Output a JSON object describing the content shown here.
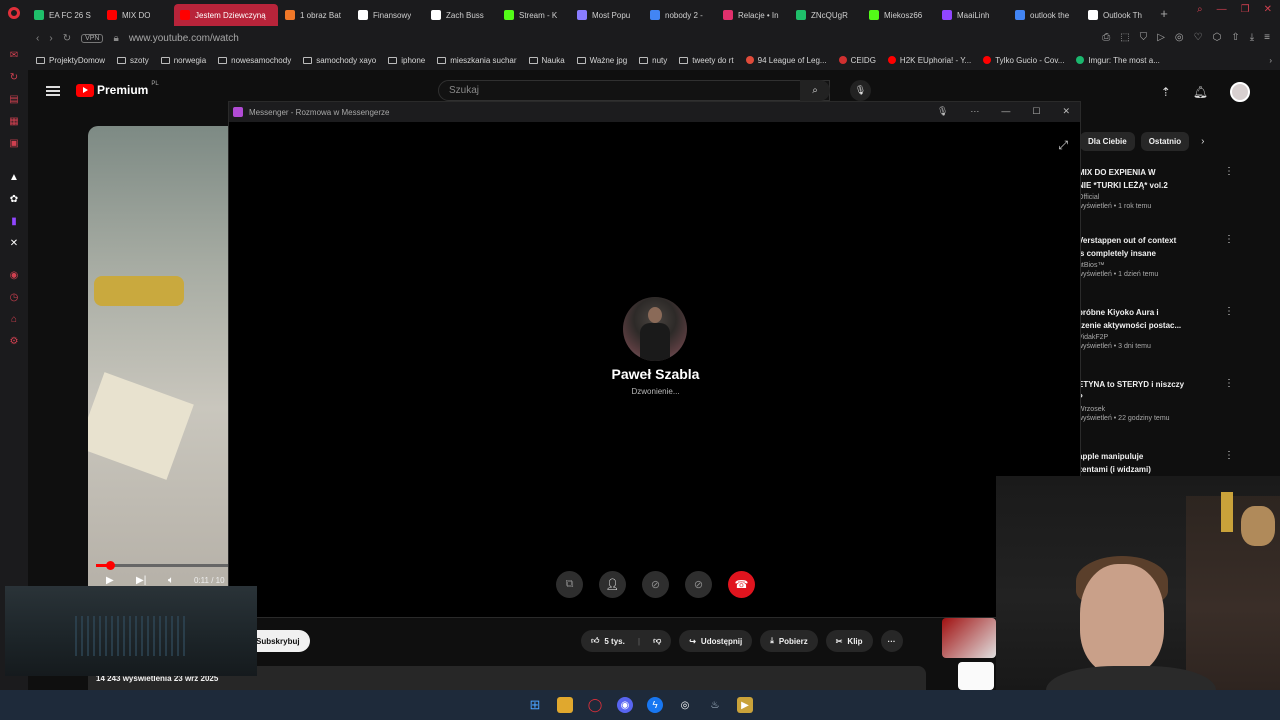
{
  "browser": {
    "tabs": [
      {
        "label": "EA FC 26 S",
        "color": "#1fbf6a",
        "active": false
      },
      {
        "label": "MIX DO",
        "color": "#ff0000",
        "active": false
      },
      {
        "label": "Jestem Dziewczyną",
        "color": "#ff0000",
        "active": true
      },
      {
        "label": "1 obraz Bat",
        "color": "#f07828",
        "active": false
      },
      {
        "label": "Finansowy",
        "color": "#ffffff",
        "active": false
      },
      {
        "label": "Zach Buss",
        "color": "#ffffff",
        "active": false
      },
      {
        "label": "Stream - K",
        "color": "#53fc18",
        "active": false
      },
      {
        "label": "Most Popu",
        "color": "#8a7cff",
        "active": false
      },
      {
        "label": "nobody 2 -",
        "color": "#4285f4",
        "active": false
      },
      {
        "label": "Relacje • In",
        "color": "#e1306c",
        "active": false
      },
      {
        "label": "ZNcQUgR",
        "color": "#1fbf6a",
        "active": false
      },
      {
        "label": "Miekosz66",
        "color": "#53fc18",
        "active": false
      },
      {
        "label": "MaaiLinh",
        "color": "#9146ff",
        "active": false
      },
      {
        "label": "outlook the",
        "color": "#4285f4",
        "active": false
      },
      {
        "label": "Outlook Th",
        "color": "#ffffff",
        "active": false
      }
    ],
    "url": "www.youtube.com/watch",
    "vpn_label": "VPN",
    "bookmarks": [
      {
        "label": "ProjektyDomow",
        "type": "folder"
      },
      {
        "label": "szoty",
        "type": "folder"
      },
      {
        "label": "norwegia",
        "type": "folder"
      },
      {
        "label": "nowesamochody",
        "type": "folder"
      },
      {
        "label": "samochody xayo",
        "type": "folder"
      },
      {
        "label": "iphone",
        "type": "folder"
      },
      {
        "label": "mieszkania suchar",
        "type": "folder"
      },
      {
        "label": "Nauka",
        "type": "folder"
      },
      {
        "label": "Ważne jpg",
        "type": "folder"
      },
      {
        "label": "nuty",
        "type": "folder"
      },
      {
        "label": "tweety do rt",
        "type": "folder"
      },
      {
        "label": "94 League of Leg...",
        "type": "site",
        "color": "#e04b3a"
      },
      {
        "label": "CEIDG",
        "type": "site",
        "color": "#d03030"
      },
      {
        "label": "H2K EUphoria! - Y...",
        "type": "site",
        "color": "#ff0000"
      },
      {
        "label": "Tylko Gucio - Cov...",
        "type": "site",
        "color": "#ff0000"
      },
      {
        "label": "Imgur: The most a...",
        "type": "site",
        "color": "#1bb76e"
      }
    ]
  },
  "youtube": {
    "logo_text": "Premium",
    "logo_region": "PL",
    "search_placeholder": "Szukaj",
    "video_time": "0:11 / 10",
    "subscribe_label": "Subskrybuj",
    "likes": "5 tys.",
    "share_label": "Udostępnij",
    "download_label": "Pobierz",
    "clip_label": "Klip",
    "views_date": "14 243 wyświetlenia  23 wrz 2025",
    "chips": [
      "Dla Ciebie",
      "Ostatnio"
    ],
    "recommendations": [
      {
        "title": "MIX DO EXPIENIA W",
        "title2": "NIE *TURKI LEŻĄ* vol.2",
        "channel": "Official",
        "meta": "wyświetleń • 1 rok temu"
      },
      {
        "title": "Verstappen out of context",
        "title2": "'s completely insane",
        "channel": "utBios™",
        "meta": "wyświetleń • 1 dzień temu"
      },
      {
        "title": "próbne Kiyoko Aura i",
        "title2": "rzenie aktywności postac...",
        "channel": "VidakF2P",
        "meta": "wyświetleń • 3 dni temu"
      },
      {
        "title": "ETYNA to STERYD i niszczy",
        "title2": "?",
        "channel": "Wrzosek",
        "meta": "wyświetleń • 22 godziny temu"
      },
      {
        "title": "apple manipuluje",
        "title2": "zentami (i widzami)",
        "channel": "",
        "meta": ""
      }
    ]
  },
  "messenger": {
    "window_title": "Messenger - Rozmowa w Messengerze",
    "caller_name": "Paweł Szabla",
    "call_status": "Dzwonienie...",
    "end_call_color": "#e0141e"
  },
  "icons": {
    "call_buttons": [
      "screen-share-icon",
      "add-person-icon",
      "camera-off-icon",
      "mic-off-icon",
      "end-call-icon"
    ]
  }
}
